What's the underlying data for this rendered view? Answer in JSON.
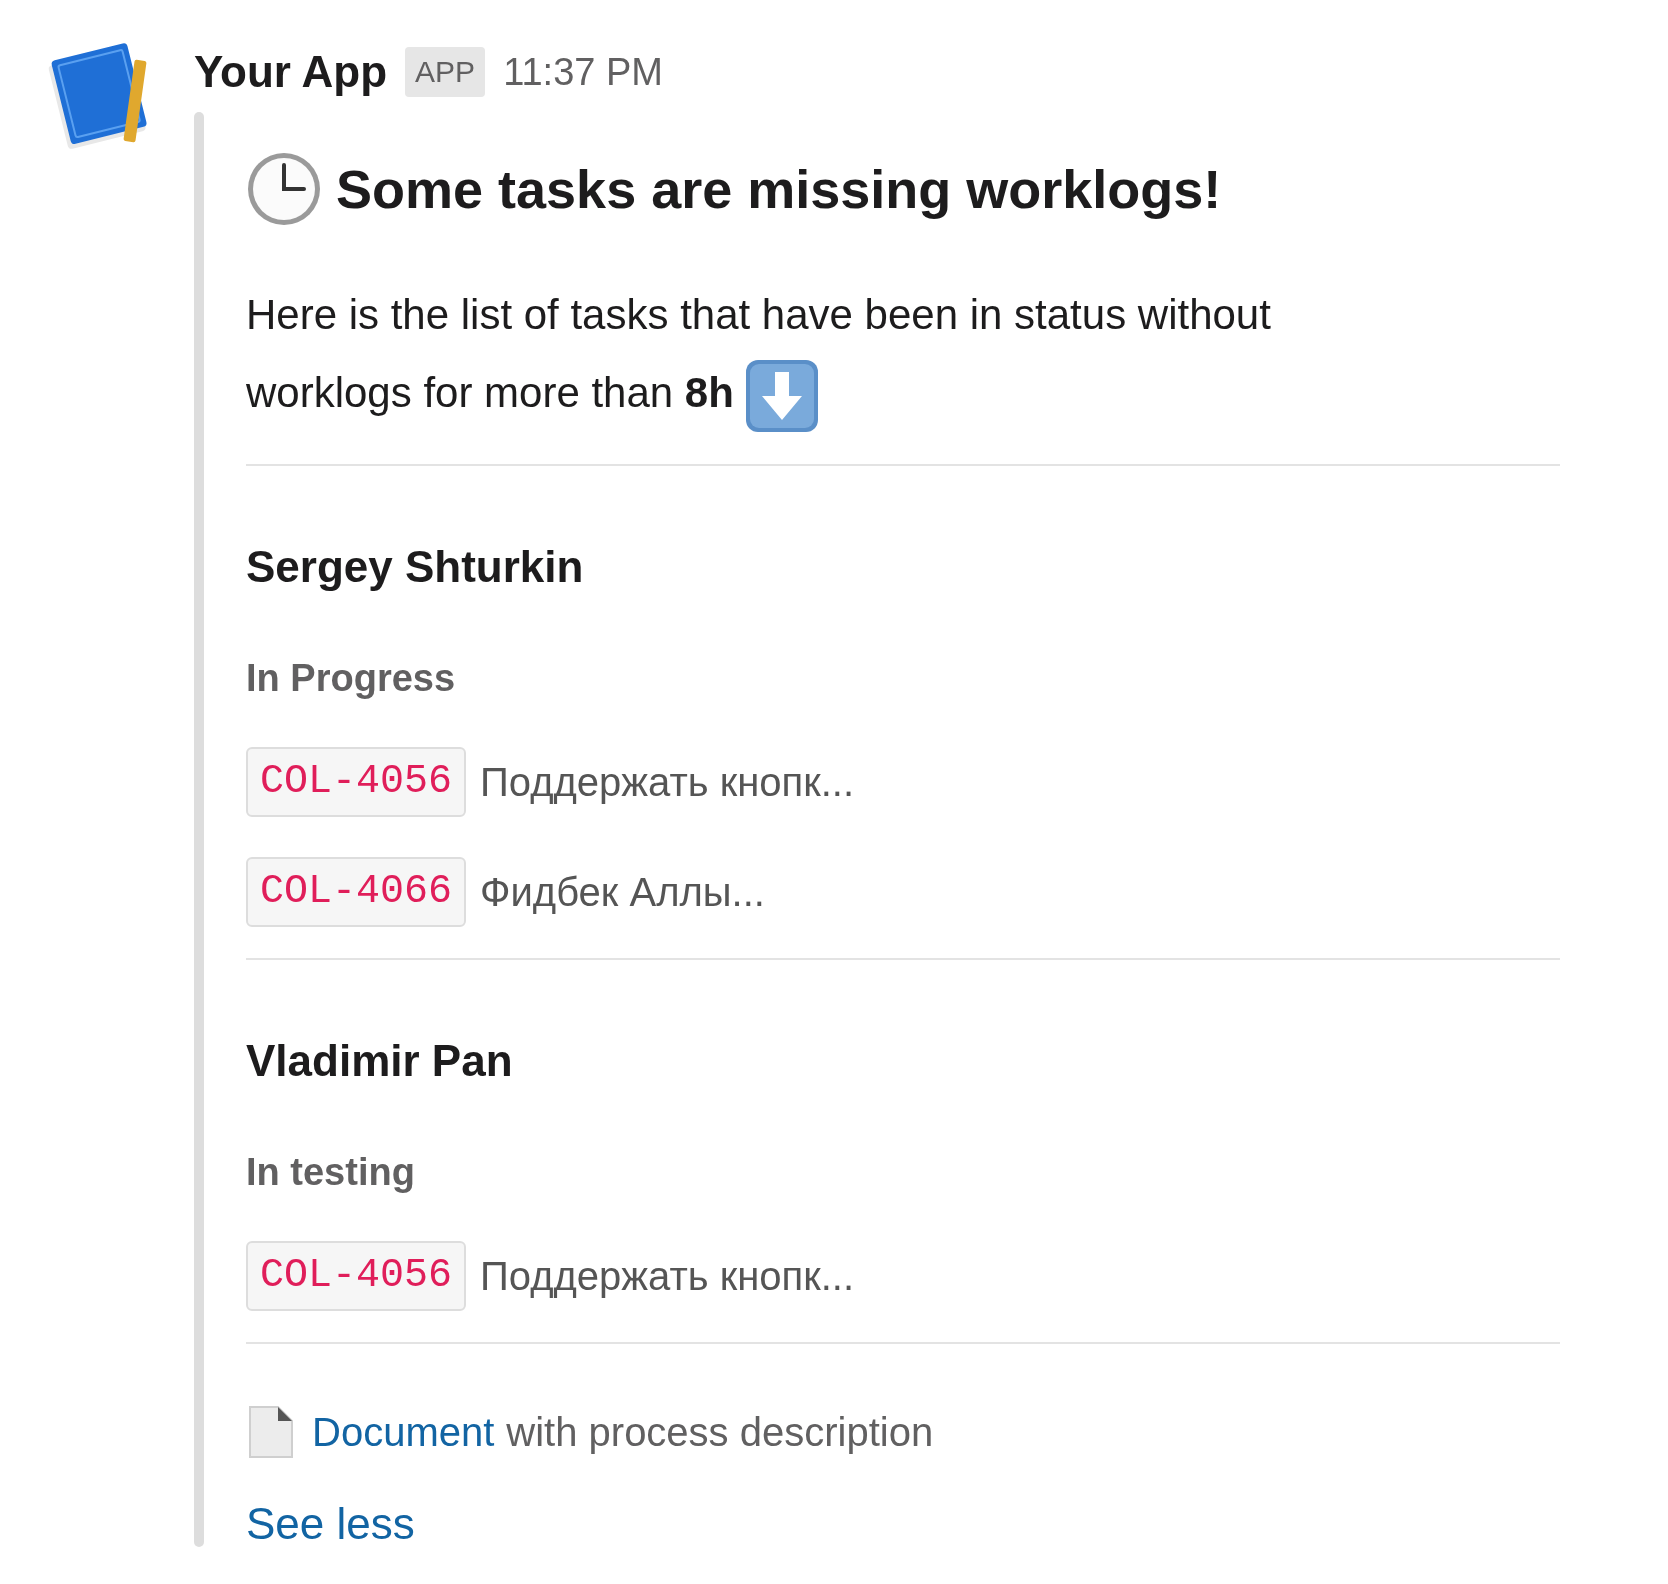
{
  "app": {
    "name": "Your App",
    "badge": "APP",
    "time": "11:37 PM"
  },
  "message": {
    "title": "Some tasks are missing worklogs!",
    "intro": "Here is the list of tasks that have been in status without worklogs for more than **8h**",
    "groups": [
      {
        "person": "Sergey Shturkin",
        "status": "In Progress",
        "tasks": [
          {
            "key": "COL-4056",
            "summary": "Поддержать кнопк..."
          },
          {
            "key": "COL-4066",
            "summary": "Фидбек Аллы..."
          }
        ]
      },
      {
        "person": "Vladimir Pan",
        "status": "In testing",
        "tasks": [
          {
            "key": "COL-4056",
            "summary": "Поддержать кнопк..."
          }
        ]
      }
    ],
    "footer": {
      "link": "Document",
      "text": "with process description"
    },
    "toggle": "See less"
  }
}
